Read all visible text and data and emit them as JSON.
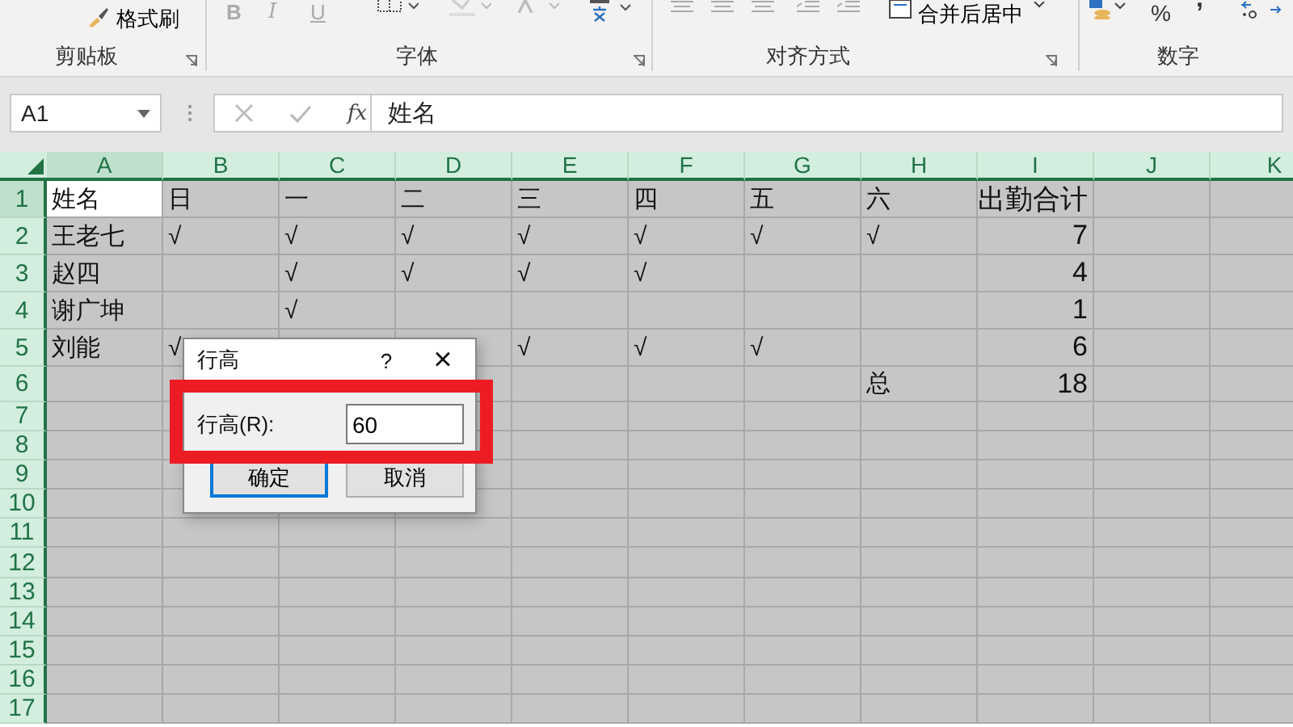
{
  "ribbon": {
    "format_painter": "格式刷",
    "merge_center": "合并后居中",
    "percent": "%",
    "comma": ",",
    "font_buttons": [
      "B",
      "I",
      "U"
    ],
    "groups": [
      {
        "label": "剪贴板"
      },
      {
        "label": "字体"
      },
      {
        "label": "对齐方式"
      },
      {
        "label": "数字"
      }
    ]
  },
  "formula_bar": {
    "name_box": "A1",
    "fx": "fx",
    "content": "姓名"
  },
  "sheet": {
    "columns": [
      {
        "label": "A",
        "active": true
      },
      {
        "label": "B",
        "active": false
      },
      {
        "label": "C",
        "active": false
      },
      {
        "label": "D",
        "active": false
      },
      {
        "label": "E",
        "active": false
      },
      {
        "label": "F",
        "active": false
      },
      {
        "label": "G",
        "active": false
      },
      {
        "label": "H",
        "active": false
      },
      {
        "label": "I",
        "active": false
      },
      {
        "label": "J",
        "active": false
      },
      {
        "label": "K",
        "active": false
      }
    ],
    "rows": [
      {
        "header": "1",
        "active": true,
        "cells": [
          "姓名",
          "日",
          "一",
          "二",
          "三",
          "四",
          "五",
          "六",
          "出勤合计"
        ]
      },
      {
        "header": "2",
        "active": false,
        "cells": [
          "王老七",
          "√",
          "√",
          "√",
          "√",
          "√",
          "√",
          "√",
          "7"
        ]
      },
      {
        "header": "3",
        "active": false,
        "cells": [
          "赵四",
          "",
          "√",
          "√",
          "√",
          "√",
          "",
          "",
          "4"
        ]
      },
      {
        "header": "4",
        "active": false,
        "cells": [
          "谢广坤",
          "",
          "√",
          "",
          "",
          "",
          "",
          "",
          "1"
        ]
      },
      {
        "header": "5",
        "active": false,
        "cells": [
          "刘能",
          "√",
          "",
          "",
          "√",
          "√",
          "√",
          "",
          "6"
        ]
      },
      {
        "header": "6",
        "active": false,
        "cells": [
          "",
          "",
          "",
          "",
          "",
          "",
          "",
          "总",
          "18"
        ]
      },
      {
        "header": "7",
        "active": false,
        "cells": []
      },
      {
        "header": "8",
        "active": false,
        "cells": []
      },
      {
        "header": "9",
        "active": false,
        "cells": []
      },
      {
        "header": "10",
        "active": false,
        "cells": []
      },
      {
        "header": "11",
        "active": false,
        "cells": []
      },
      {
        "header": "12",
        "active": false,
        "cells": []
      },
      {
        "header": "13",
        "active": false,
        "cells": []
      },
      {
        "header": "14",
        "active": false,
        "cells": []
      },
      {
        "header": "15",
        "active": false,
        "cells": []
      },
      {
        "header": "16",
        "active": false,
        "cells": []
      },
      {
        "header": "17",
        "active": false,
        "cells": []
      }
    ]
  },
  "dialog": {
    "title": "行高",
    "help": "?",
    "close": "×",
    "label": "行高(R):",
    "value": "60",
    "buttons": [
      {
        "label": "确定",
        "default": true
      },
      {
        "label": "取消",
        "default": false
      }
    ]
  }
}
